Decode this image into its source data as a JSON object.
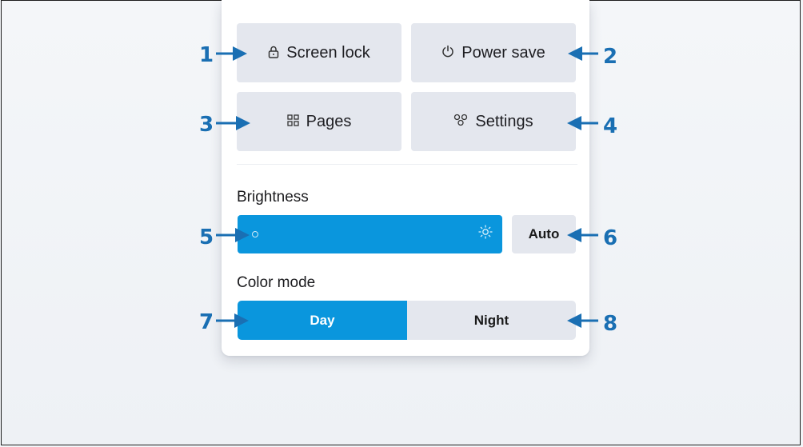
{
  "quick_tiles": [
    {
      "label": "Screen lock",
      "icon": "lock-icon",
      "glyph": "⌂"
    },
    {
      "label": "Power save",
      "icon": "power-icon",
      "glyph": "⏻"
    },
    {
      "label": "Pages",
      "icon": "grid-icon",
      "glyph": "⊞"
    },
    {
      "label": "Settings",
      "icon": "gear-icon",
      "glyph": "⚙"
    }
  ],
  "brightness": {
    "title": "Brightness",
    "auto_label": "Auto",
    "level": 0
  },
  "color_mode": {
    "title": "Color mode",
    "options": [
      "Day",
      "Night"
    ],
    "selected": "Day"
  },
  "callouts": [
    "1",
    "2",
    "3",
    "4",
    "5",
    "6",
    "7",
    "8"
  ],
  "colors": {
    "accent": "#0a96dd",
    "tile": "#e4e7ee",
    "callout": "#1a6fb3"
  }
}
